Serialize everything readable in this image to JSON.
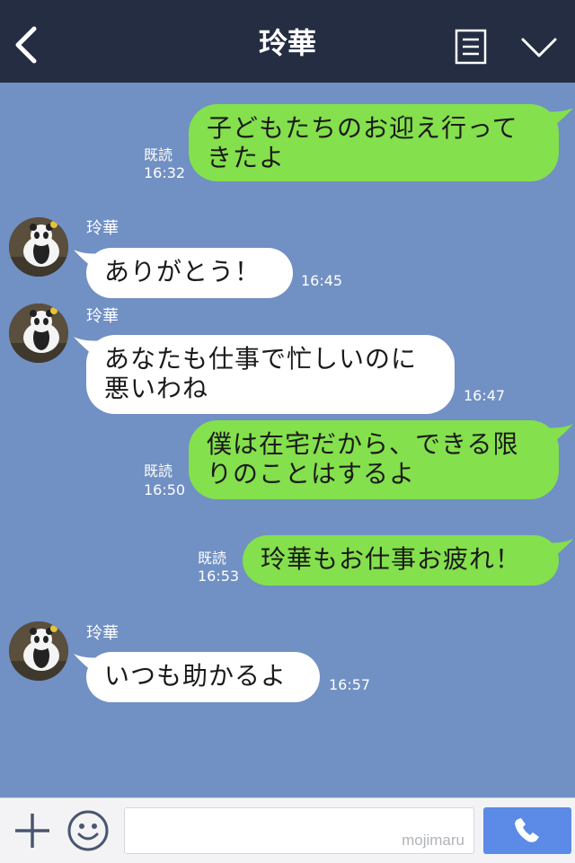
{
  "header": {
    "title": "玲華",
    "icons": {
      "back": "chevron-left-icon",
      "menu": "list-menu-icon",
      "dropdown": "chevron-down-icon"
    }
  },
  "messages": [
    {
      "from": "me",
      "text": "子どもたちのお迎え行って\nきたよ",
      "read": "既読",
      "time": "16:32"
    },
    {
      "from": "them",
      "sender": "玲華",
      "text": "ありがとう！",
      "time": "16:45"
    },
    {
      "from": "them",
      "sender": "玲華",
      "text": "あなたも仕事で忙しいのに\n悪いわね",
      "time": "16:47"
    },
    {
      "from": "me",
      "text": "僕は在宅だから、できる限\nりのことはするよ",
      "read": "既読",
      "time": "16:50"
    },
    {
      "from": "me",
      "text": "玲華もお仕事お疲れ！",
      "read": "既読",
      "time": "16:53"
    },
    {
      "from": "them",
      "sender": "玲華",
      "text": "いつも助かるよ",
      "time": "16:57"
    }
  ],
  "composer": {
    "input_value": "",
    "watermark": "mojimaru",
    "icons": {
      "add": "plus-icon",
      "emoji": "smiley-icon",
      "call": "phone-icon"
    }
  },
  "colors": {
    "header_bg": "#242d42",
    "chat_bg": "#7190c3",
    "my_bubble": "#84e04c",
    "their_bubble": "#ffffff",
    "call_button": "#5b8be6"
  }
}
